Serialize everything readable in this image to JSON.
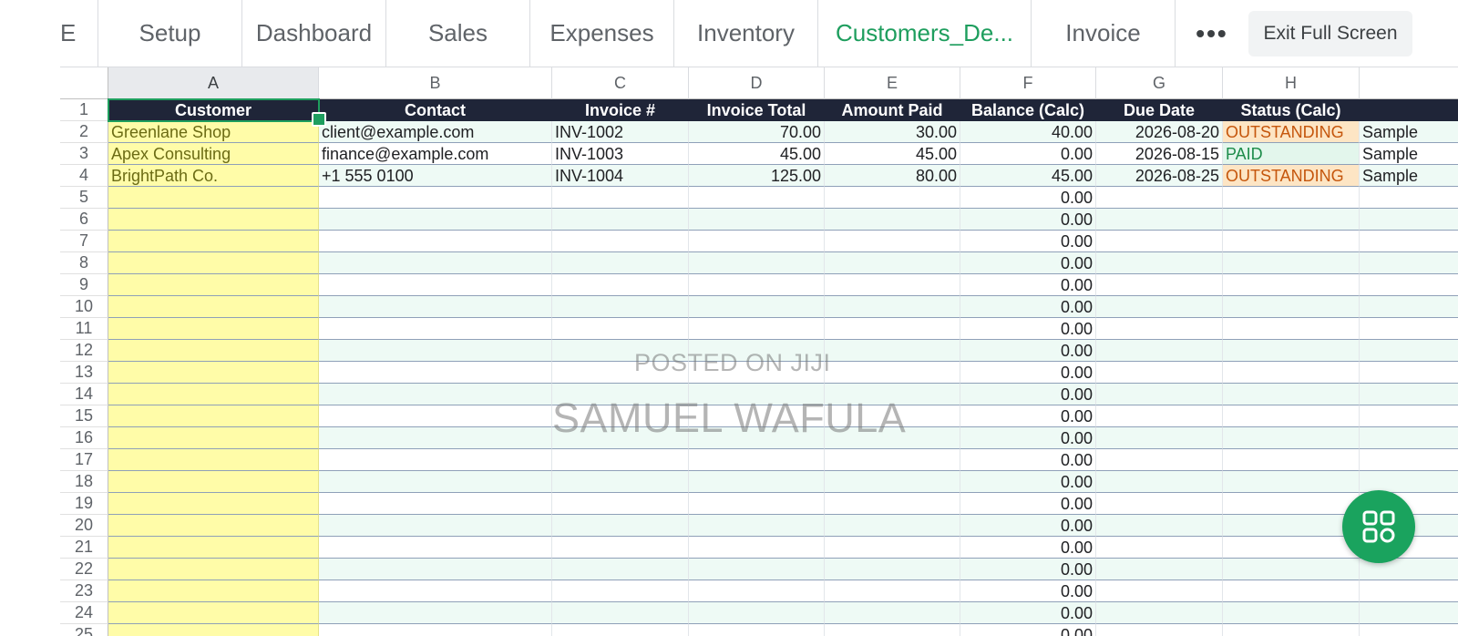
{
  "tabs": [
    {
      "label": "E",
      "active": false
    },
    {
      "label": "Setup",
      "active": false
    },
    {
      "label": "Dashboard",
      "active": false
    },
    {
      "label": "Sales",
      "active": false
    },
    {
      "label": "Expenses",
      "active": false
    },
    {
      "label": "Inventory",
      "active": false
    },
    {
      "label": "Customers_De...",
      "active": true
    },
    {
      "label": "Invoice",
      "active": false
    }
  ],
  "more_label": "•••",
  "exit_label": "Exit Full Screen",
  "columns": [
    "A",
    "B",
    "C",
    "D",
    "E",
    "F",
    "G",
    "H"
  ],
  "selected_column": "A",
  "header_row": [
    "Customer",
    "Contact",
    "Invoice #",
    "Invoice Total",
    "Amount Paid",
    "Balance (Calc)",
    "Due Date",
    "Status (Calc)",
    ""
  ],
  "data_rows": [
    {
      "n": "2",
      "cells": [
        "Greenlane Shop",
        "client@example.com",
        "INV-1002",
        "70.00",
        "30.00",
        "40.00",
        "2026-08-20",
        "OUTSTANDING",
        "Sample"
      ],
      "status": "outstanding"
    },
    {
      "n": "3",
      "cells": [
        "Apex Consulting",
        "finance@example.com",
        "INV-1003",
        "45.00",
        "45.00",
        "0.00",
        "2026-08-15",
        "PAID",
        "Sample"
      ],
      "status": "paid"
    },
    {
      "n": "4",
      "cells": [
        "BrightPath Co.",
        "+1 555 0100",
        "INV-1004",
        "125.00",
        "80.00",
        "45.00",
        "2026-08-25",
        "OUTSTANDING",
        "Sample"
      ],
      "status": "outstanding"
    }
  ],
  "empty_rows": [
    "5",
    "6",
    "7",
    "8",
    "9",
    "10",
    "11",
    "12",
    "13",
    "14",
    "15",
    "16",
    "17",
    "18",
    "19",
    "20",
    "21",
    "22",
    "23",
    "24",
    "25"
  ],
  "empty_balance": "0.00",
  "header_row_number": "1",
  "watermark_line1": "POSTED ON JIJI",
  "watermark_line2": "SAMUEL WAFULA",
  "fab_icon": "grid-apps-icon",
  "colors": {
    "accent": "#1e9e5e",
    "header_bg": "#1f2538",
    "column_a": "#fffca8",
    "band": "#eefaf5",
    "outstanding_bg": "#fde5c4",
    "outstanding_text": "#c5560c",
    "paid_bg": "#e3f6ec",
    "paid_text": "#1d8c4a"
  }
}
